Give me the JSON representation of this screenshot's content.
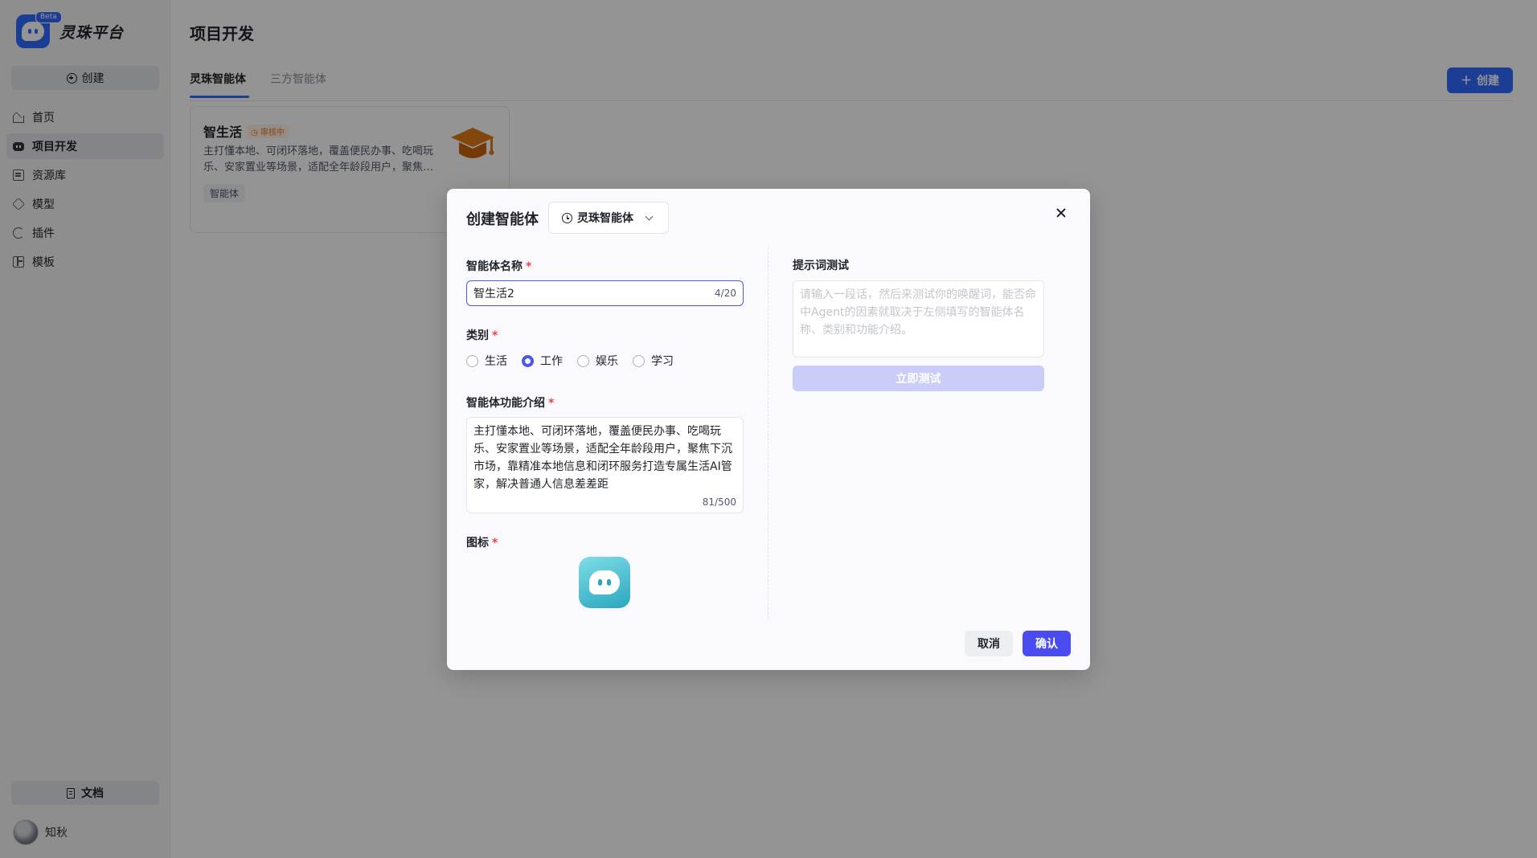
{
  "app": {
    "name": "灵珠平台",
    "badge": "Beta"
  },
  "sidebar": {
    "create_label": "创建",
    "items": [
      {
        "label": "首页",
        "icon": "home-icon"
      },
      {
        "label": "项目开发",
        "icon": "project-icon",
        "active": true
      },
      {
        "label": "资源库",
        "icon": "library-icon"
      },
      {
        "label": "模型",
        "icon": "model-icon"
      },
      {
        "label": "插件",
        "icon": "plugin-icon"
      },
      {
        "label": "模板",
        "icon": "template-icon"
      }
    ],
    "docs_label": "文档",
    "user_name": "知秋"
  },
  "main": {
    "title": "项目开发",
    "tabs": [
      {
        "label": "灵珠智能体",
        "active": true
      },
      {
        "label": "三方智能体"
      }
    ],
    "create_label": "创建",
    "card": {
      "title": "智生活",
      "status": "审核中",
      "desc": "主打懂本地、可闭环落地，覆盖便民办事、吃喝玩乐、安家置业等场景，适配全年龄段用户，聚焦下沉市场，靠精准本地信息和闭环服务打造专属生活AI管家",
      "tag": "智能体"
    }
  },
  "modal": {
    "title": "创建智能体",
    "type_select": "灵珠智能体",
    "name_label": "智能体名称",
    "name_value": "智生活2",
    "name_counter": "4/20",
    "category_label": "类别",
    "categories": [
      {
        "label": "生活",
        "checked": false
      },
      {
        "label": "工作",
        "checked": true
      },
      {
        "label": "娱乐",
        "checked": false
      },
      {
        "label": "学习",
        "checked": false
      }
    ],
    "desc_label": "智能体功能介绍",
    "desc_value": "主打懂本地、可闭环落地，覆盖便民办事、吃喝玩乐、安家置业等场景，适配全年龄段用户，聚焦下沉市场，靠精准本地信息和闭环服务打造专属生活AI管家，解决普通人信息差差距",
    "desc_counter": "81/500",
    "icon_label": "图标",
    "prompt_label": "提示词测试",
    "prompt_placeholder": "请输入一段话，然后来测试你的唤醒词，能否命中Agent的因素就取决于左侧填写的智能体名称、类别和功能介绍。",
    "test_button": "立即测试",
    "cancel_button": "取消",
    "confirm_button": "确认"
  },
  "colors": {
    "primary": "#2f6bff",
    "accent": "#4a56f0",
    "required": "#f53f3f"
  }
}
